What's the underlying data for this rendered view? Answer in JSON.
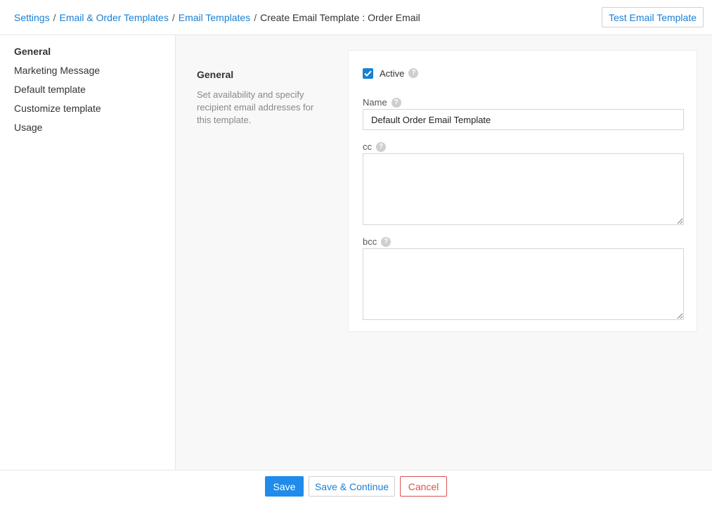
{
  "breadcrumb": {
    "items": [
      "Settings",
      "Email & Order Templates",
      "Email Templates"
    ],
    "current": "Create Email Template : Order Email",
    "separator": "/"
  },
  "header": {
    "test_button": "Test Email Template"
  },
  "sidebar": {
    "items": [
      {
        "label": "General",
        "active": true
      },
      {
        "label": "Marketing Message"
      },
      {
        "label": "Default template"
      },
      {
        "label": "Customize template"
      },
      {
        "label": "Usage"
      }
    ]
  },
  "section": {
    "title": "General",
    "description": "Set availability and specify recipient email addresses for this template."
  },
  "form": {
    "active_label": "Active",
    "active_checked": true,
    "help_glyph": "?",
    "name_label": "Name",
    "name_value": "Default Order Email Template",
    "cc_label": "cc",
    "cc_value": "",
    "bcc_label": "bcc",
    "bcc_value": ""
  },
  "footer": {
    "save": "Save",
    "save_continue": "Save & Continue",
    "cancel": "Cancel"
  },
  "colors": {
    "accent": "#1f8ceb",
    "link": "#1a7fd4",
    "danger": "#d9534f",
    "background": "#f8f8f8"
  },
  "icons": [
    "check-icon",
    "help-icon",
    "resize-handle-icon"
  ]
}
